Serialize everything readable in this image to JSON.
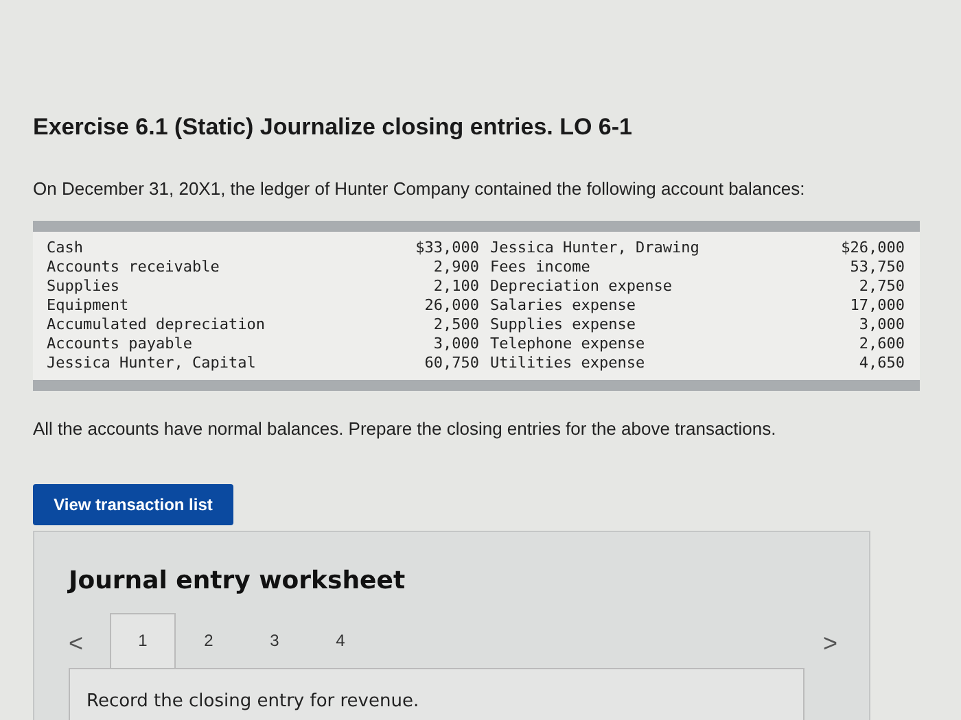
{
  "title": "Exercise 6.1 (Static) Journalize closing entries. LO 6-1",
  "intro": "On December 31, 20X1, the ledger of Hunter Company contained the following account balances:",
  "accounts": [
    {
      "name": "Cash",
      "amount": "$33,000",
      "name_2": "Jessica Hunter, Drawing",
      "amount_2": "$26,000"
    },
    {
      "name": "Accounts receivable",
      "amount": "2,900",
      "name_2": "Fees income",
      "amount_2": "53,750"
    },
    {
      "name": "Supplies",
      "amount": "2,100",
      "name_2": "Depreciation expense",
      "amount_2": "2,750"
    },
    {
      "name": "Equipment",
      "amount": "26,000",
      "name_2": "Salaries expense",
      "amount_2": "17,000"
    },
    {
      "name": "Accumulated depreciation",
      "amount": "2,500",
      "name_2": "Supplies expense",
      "amount_2": "3,000"
    },
    {
      "name": "Accounts payable",
      "amount": "3,000",
      "name_2": "Telephone expense",
      "amount_2": "2,600"
    },
    {
      "name": "Jessica Hunter, Capital",
      "amount": "60,750",
      "name_2": "Utilities expense",
      "amount_2": "4,650"
    }
  ],
  "instruction": "All the accounts have normal balances. Prepare the closing entries for the above transactions.",
  "view_button": "View transaction list",
  "worksheet": {
    "title": "Journal entry worksheet",
    "prev": "<",
    "next": ">",
    "tabs": [
      {
        "label": "1",
        "selected": true
      },
      {
        "label": "2",
        "selected": false
      },
      {
        "label": "3",
        "selected": false
      },
      {
        "label": "4",
        "selected": false
      }
    ],
    "prompt": "Record the closing entry for revenue."
  }
}
